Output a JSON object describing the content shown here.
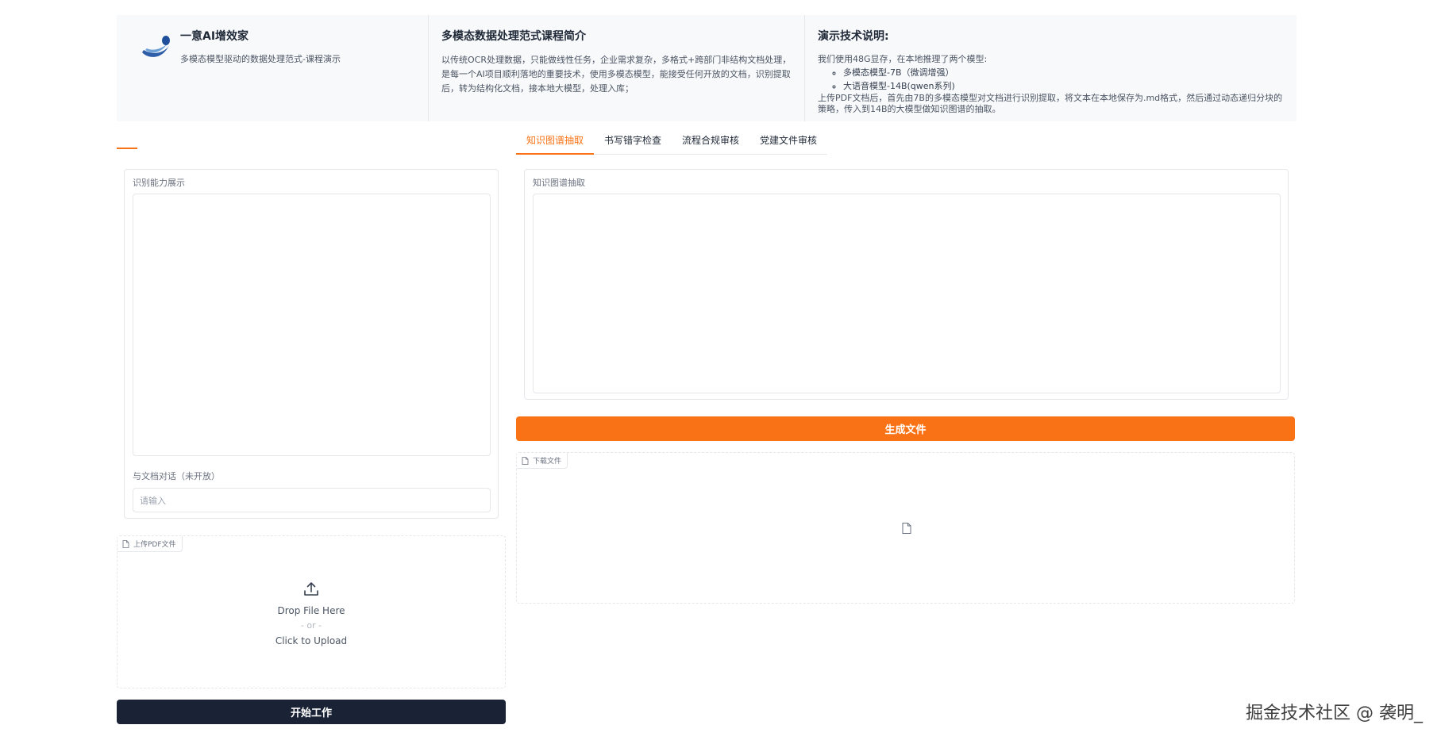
{
  "header": {
    "brand": {
      "title": "一意AI增效家",
      "subtitle": "多模态模型驱动的数据处理范式-课程演示"
    },
    "course": {
      "title": "多模态数据处理范式课程简介",
      "description": "以传统OCR处理数据，只能做线性任务，企业需求复杂，多格式+跨部门非结构文档处理，是每一个AI项目顺利落地的重要技术，使用多模态模型，能接受任何开放的文档，识别提取后，转为结构化文档，接本地大模型，处理入库；"
    },
    "tech": {
      "title": "演示技术说明:",
      "intro": "我们使用48G显存，在本地推理了两个模型:",
      "models": [
        "多模态模型-7B（微调增强）",
        "大语音模型-14B(qwen系列)"
      ],
      "footnote": "上传PDF文档后，首先由7B的多模态模型对文档进行识别提取，将文本在本地保存为.md格式，然后通过动态递归分块的策略，传入到14B的大模型做知识图谱的抽取。"
    }
  },
  "tabs": [
    {
      "label": "知识图谱抽取",
      "active": true
    },
    {
      "label": "书写错字检查",
      "active": false
    },
    {
      "label": "流程合规审核",
      "active": false
    },
    {
      "label": "党建文件审核",
      "active": false
    }
  ],
  "left_panel": {
    "recognition_label": "识别能力展示",
    "chat_label": "与文档对话（未开放）",
    "chat_placeholder": "请输入"
  },
  "upload": {
    "tag": "上传PDF文件",
    "drop_text": "Drop File Here",
    "or_text": "- or -",
    "click_text": "Click to Upload"
  },
  "start_button": "开始工作",
  "right_panel": {
    "kg_label": "知识图谱抽取"
  },
  "generate_button": "生成文件",
  "download": {
    "tag": "下载文件"
  },
  "watermark": "掘金技术社区 @ 袭明_",
  "colors": {
    "accent": "#f97316",
    "dark_button": "#1a2236",
    "header_bg": "#f8f9fb"
  },
  "icons": [
    "logo-icon",
    "file-icon",
    "upload-icon"
  ]
}
